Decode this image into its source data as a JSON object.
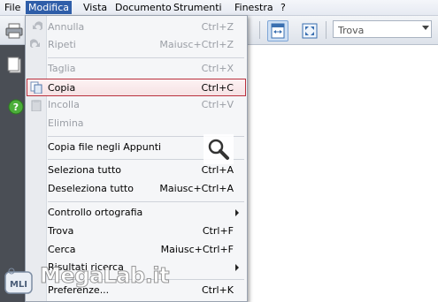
{
  "menubar": {
    "items": [
      "File",
      "Modifica",
      "Vista",
      "Documento",
      "Strumenti",
      "Finestra",
      "?"
    ],
    "active_index": 1
  },
  "toolbar": {
    "search_value": "Trova"
  },
  "menu": {
    "items": [
      {
        "label": "Annulla",
        "shortcut": "Ctrl+Z",
        "disabled": true,
        "icon": "undo-icon"
      },
      {
        "label": "Ripeti",
        "shortcut": "Maiusc+Ctrl+Z",
        "disabled": true,
        "icon": "redo-icon"
      },
      {
        "label": "Taglia",
        "shortcut": "Ctrl+X",
        "disabled": true
      },
      {
        "label": "Copia",
        "shortcut": "Ctrl+C",
        "disabled": false,
        "highlighted": true,
        "icon": "copy-icon"
      },
      {
        "label": "Incolla",
        "shortcut": "Ctrl+V",
        "disabled": true,
        "icon": "paste-icon"
      },
      {
        "label": "Elimina",
        "shortcut": "",
        "disabled": true
      },
      {
        "label": "Copia file negli Appunti",
        "shortcut": "",
        "disabled": false
      },
      {
        "label": "Seleziona tutto",
        "shortcut": "Ctrl+A",
        "disabled": false
      },
      {
        "label": "Deseleziona tutto",
        "shortcut": "Maiusc+Ctrl+A",
        "disabled": false
      },
      {
        "label": "Controllo ortografia",
        "shortcut": "",
        "disabled": false,
        "submenu": true
      },
      {
        "label": "Trova",
        "shortcut": "Ctrl+F",
        "disabled": false
      },
      {
        "label": "Cerca",
        "shortcut": "Maiusc+Ctrl+F",
        "disabled": false
      },
      {
        "label": "Risultati ricerca",
        "shortcut": "",
        "disabled": false,
        "submenu": true
      },
      {
        "label": "Preferenze...",
        "shortcut": "Ctrl+K",
        "disabled": false
      }
    ]
  },
  "watermark": {
    "logo_text": "MegaLab.it",
    "badge_text": "MLI"
  },
  "colors": {
    "menu_active": "#2f5ea9",
    "highlight_border": "#b9303d",
    "left_panel": "#4a4e55"
  }
}
